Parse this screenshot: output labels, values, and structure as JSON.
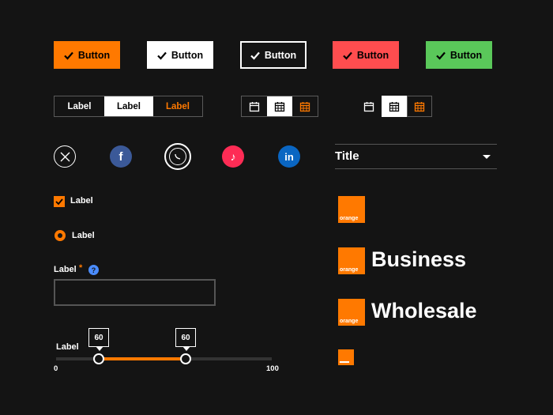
{
  "buttons": [
    {
      "label": "Button",
      "bg": "#ff7900",
      "fg": "#000000"
    },
    {
      "label": "Button",
      "bg": "#ffffff",
      "fg": "#000000"
    },
    {
      "label": "Button",
      "bg": "#141414",
      "fg": "#ffffff"
    },
    {
      "label": "Button",
      "bg": "#ff4d4f",
      "fg": "#000000"
    },
    {
      "label": "Button",
      "bg": "#5ac85a",
      "fg": "#000000"
    }
  ],
  "segmented_labels": [
    "Label",
    "Label",
    "Label"
  ],
  "social_icons": [
    "x-icon",
    "facebook-icon",
    "whatsapp-icon",
    "tiktok-icon",
    "linkedin-icon"
  ],
  "dropdown": {
    "title": "Title"
  },
  "checkbox": {
    "label": "Label",
    "checked": true
  },
  "radio": {
    "label": "Label",
    "checked": true
  },
  "field": {
    "label": "Label",
    "required_mark": "*",
    "help_icon": "?",
    "value": ""
  },
  "slider": {
    "label": "Label",
    "min": "0",
    "max": "100",
    "low": "60",
    "high": "60"
  },
  "logos": {
    "orange_text": "orange",
    "business": "Business",
    "wholesale": "Wholesale"
  },
  "colors": {
    "accent": "#ff7900",
    "background": "#141414",
    "help": "#4a8cff"
  }
}
